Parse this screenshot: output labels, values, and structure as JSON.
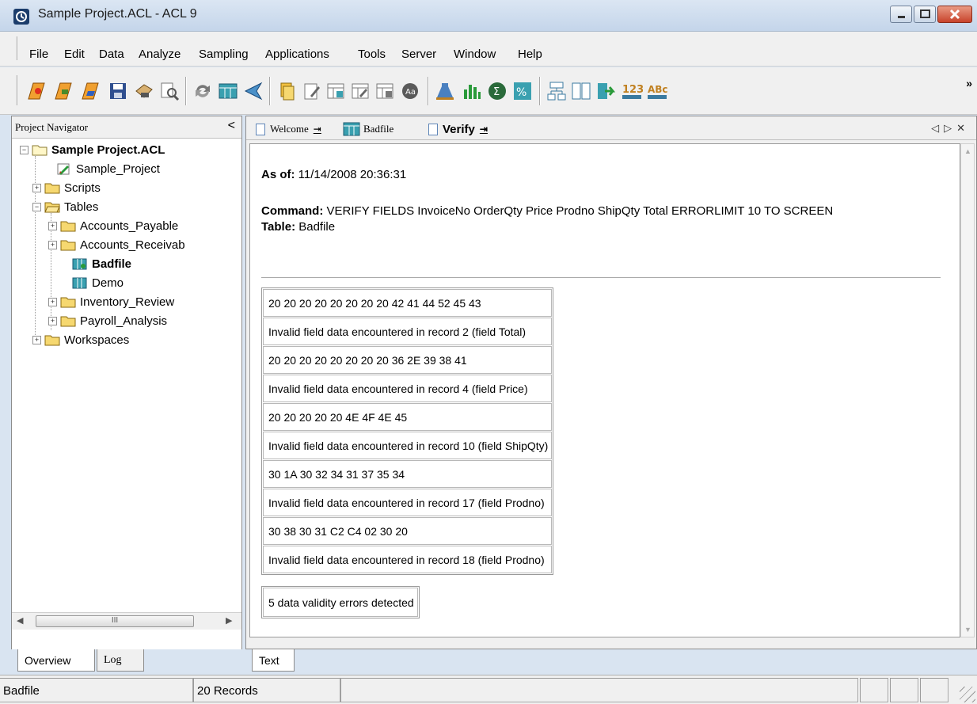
{
  "window": {
    "title": "Sample Project.ACL - ACL 9"
  },
  "menu": [
    "File",
    "Edit",
    "Data",
    "Analyze",
    "Sampling",
    "Applications",
    "Tools",
    "Server",
    "Window",
    "Help"
  ],
  "navigator": {
    "header": "Project Navigator",
    "root": "Sample Project.ACL",
    "items": {
      "project": "Sample_Project",
      "scripts": "Scripts",
      "tables": "Tables",
      "ap": "Accounts_Payable",
      "ar": "Accounts_Receivab",
      "badfile": "Badfile",
      "demo": "Demo",
      "inventory": "Inventory_Review",
      "payroll": "Payroll_Analysis",
      "workspaces": "Workspaces"
    },
    "tabs": {
      "overview": "Overview",
      "log": "Log"
    }
  },
  "doc_tabs": {
    "welcome": "Welcome",
    "badfile": "Badfile",
    "verify": "Verify"
  },
  "result": {
    "asof_label": "As of:",
    "asof_value": "11/14/2008 20:36:31",
    "command_label": "Command:",
    "command_value": "VERIFY FIELDS InvoiceNo OrderQty Price Prodno ShipQty Total ERRORLIMIT 10 TO SCREEN",
    "table_label": "Table:",
    "table_value": "Badfile",
    "rows": [
      "20 20 20 20 20 20 20 20 42 41 44 52 45 43",
      "Invalid field data encountered in record 2 (field Total)",
      "20 20 20 20 20 20 20 20 36 2E 39 38 41",
      "Invalid field data encountered in record 4 (field Price)",
      "20 20 20 20 20 4E 4F 4E 45",
      "Invalid field data encountered in record 10 (field ShipQty)",
      "30 1A 30 32 34 31 37 35 34",
      "Invalid field data encountered in record 17 (field Prodno)",
      "30 38 30 31 C2 C4 02 30 20",
      "Invalid field data encountered in record 18 (field Prodno)"
    ],
    "summary": "5 data validity errors detected"
  },
  "bottom_tab": "Text",
  "status": {
    "table": "Badfile",
    "records": "20 Records"
  },
  "icons": {
    "toolbar": [
      "new-project-icon",
      "open-project-icon",
      "open-table-icon",
      "save-icon",
      "print-icon",
      "search-icon",
      "refresh-icon",
      "table-layout-icon",
      "filter-icon",
      "copy-icon",
      "edit-icon",
      "add-column-icon",
      "edit-column-icon",
      "remove-column-icon",
      "font-icon",
      "verify-icon",
      "histogram-icon",
      "total-icon",
      "percent-icon",
      "structure-icon",
      "split-icon",
      "extract-icon",
      "numbers-icon",
      "text-icon"
    ]
  }
}
